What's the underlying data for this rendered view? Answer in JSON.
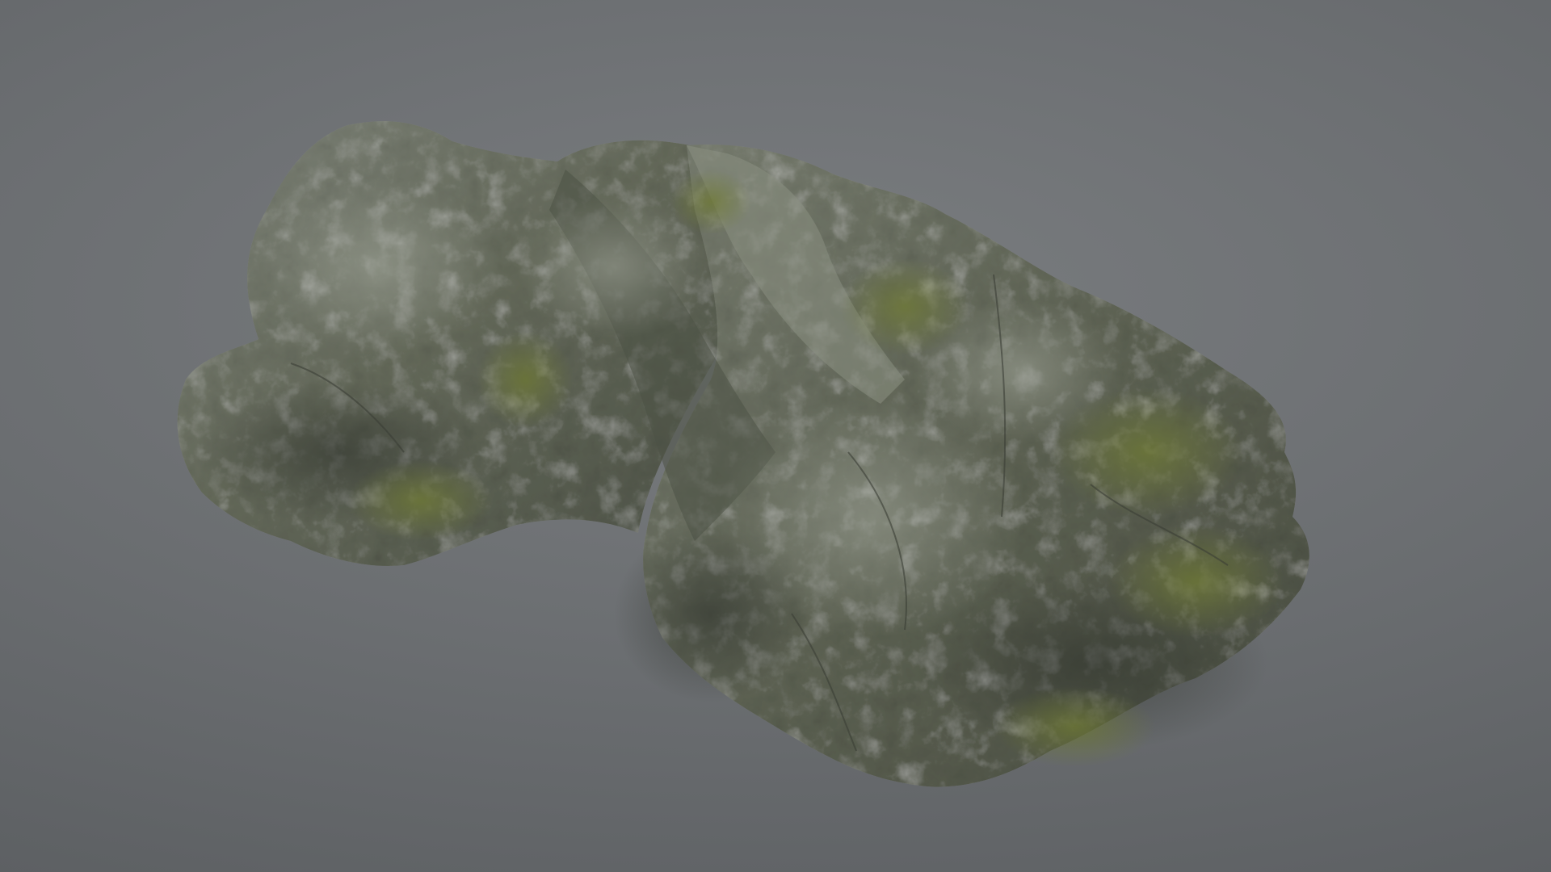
{
  "scene": {
    "subject_icon": "rock-icon",
    "colors": {
      "background_light": "#7a7d80",
      "background_dark": "#575a5d",
      "rock_base": "#5f6458",
      "rock_highlight": "#8a8f84",
      "rock_shadow": "#3d413a",
      "moss": "#6f7a3a"
    }
  }
}
